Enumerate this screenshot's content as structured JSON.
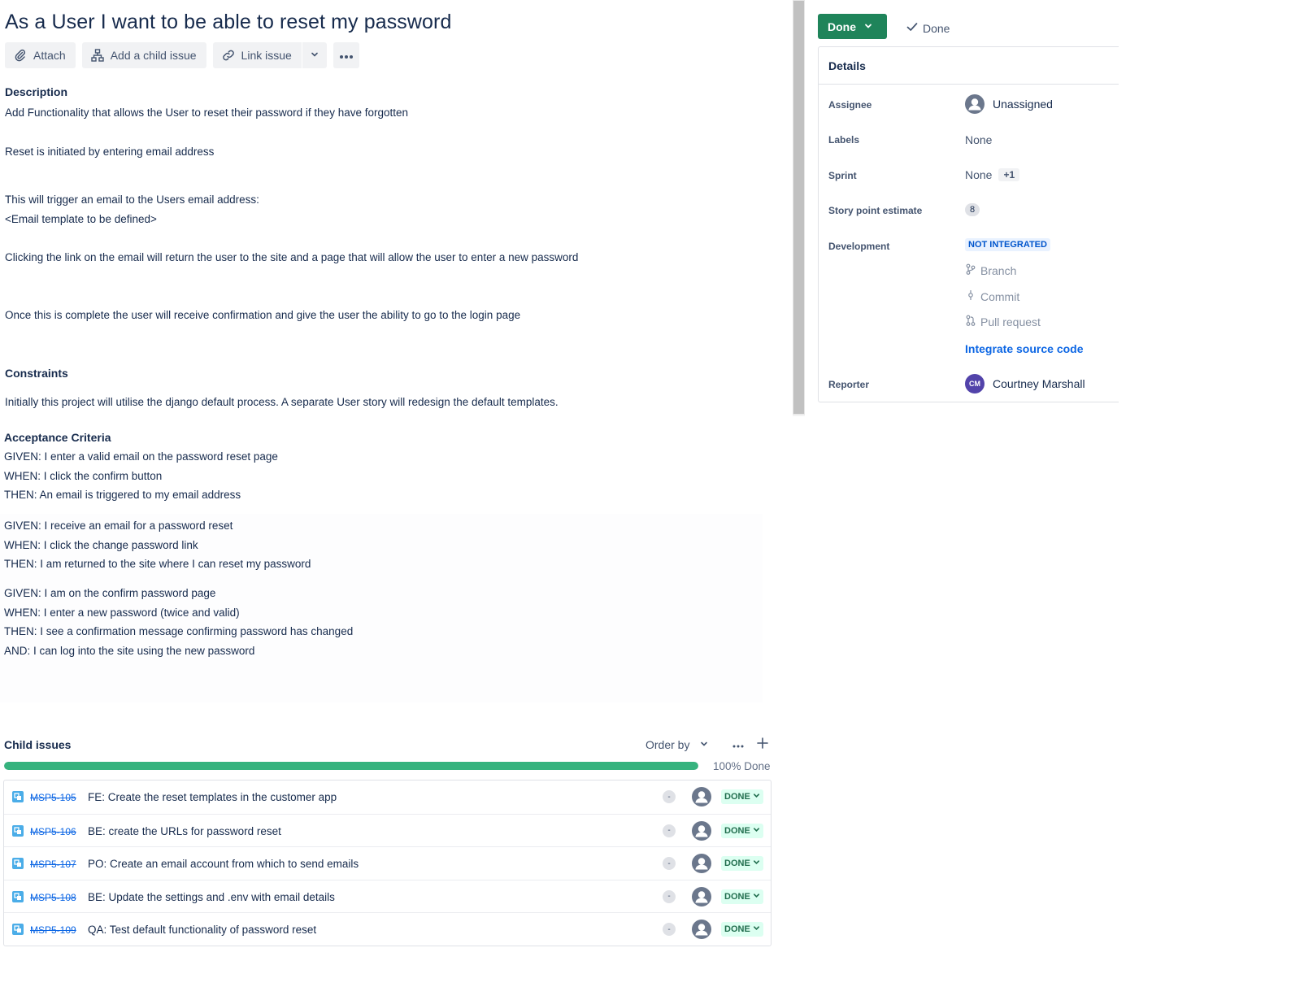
{
  "issue": {
    "title": "As a User I want to be able to reset my password"
  },
  "toolbar": {
    "attach": "Attach",
    "add_child": "Add a child issue",
    "link_issue": "Link issue"
  },
  "description": {
    "label": "Description",
    "paragraphs": [
      "Add Functionality that allows the User to reset their password if they have forgotten",
      "Reset is initiated by entering email address",
      "This will trigger an email to the Users email address:",
      "<Email template to be defined>",
      "Clicking the link on the email will return the user to the site and a page that will allow the user to enter a new password",
      "Once this is complete the user will receive confirmation and give the user the ability to go to the login page"
    ],
    "constraints_label": "Constraints",
    "constraints_text": "Initially this project will utilise the django default process. A separate User story will redesign the default templates.",
    "acceptance_label": "Acceptance Criteria",
    "acceptance": [
      "GIVEN: I enter a valid email on the password reset page",
      "WHEN: I click the confirm button",
      "THEN: An email is triggered to my email address",
      "GIVEN: I receive an email for a password reset",
      "WHEN: I click the change password link",
      "THEN: I am returned to the site where I can reset my password",
      "GIVEN: I am on the confirm password page",
      "WHEN: I enter a new password (twice and valid)",
      "THEN: I see a confirmation message confirming password has changed",
      "AND: I can log into the site using the new password"
    ]
  },
  "child_issues": {
    "label": "Child issues",
    "order_by": "Order by",
    "progress_percent": 100,
    "progress_text": "100% Done",
    "rows": [
      {
        "key": "MSP5-105",
        "summary": "FE: Create the reset templates in the customer app",
        "priority": "-",
        "status": "DONE"
      },
      {
        "key": "MSP5-106",
        "summary": "BE: create the URLs for password reset",
        "priority": "-",
        "status": "DONE"
      },
      {
        "key": "MSP5-107",
        "summary": "PO: Create an email account from which to send emails",
        "priority": "-",
        "status": "DONE"
      },
      {
        "key": "MSP5-108",
        "summary": "BE: Update the settings and .env with email details",
        "priority": "-",
        "status": "DONE"
      },
      {
        "key": "MSP5-109",
        "summary": "QA: Test default functionality of password reset",
        "priority": "-",
        "status": "DONE"
      }
    ]
  },
  "sidebar": {
    "status_button": "Done",
    "resolution": "Done",
    "details_label": "Details",
    "fields": {
      "assignee_label": "Assignee",
      "assignee_value": "Unassigned",
      "labels_label": "Labels",
      "labels_value": "None",
      "sprint_label": "Sprint",
      "sprint_value": "None",
      "sprint_extra": "+1",
      "story_points_label": "Story point estimate",
      "story_points_value": "8",
      "development_label": "Development",
      "development_status": "NOT INTEGRATED",
      "dev_branch": "Branch",
      "dev_commit": "Commit",
      "dev_pull_request": "Pull request",
      "integrate_link": "Integrate source code",
      "reporter_label": "Reporter",
      "reporter_initials": "CM",
      "reporter_name": "Courtney Marshall"
    }
  },
  "colors": {
    "status_green": "#1f845a",
    "progress_green": "#36b37e",
    "link_blue": "#0c66e4",
    "done_lozenge_bg": "#dcfff1",
    "reporter_avatar": "#5243aa"
  },
  "icons": [
    "paperclip-icon",
    "hierarchy-icon",
    "link-icon",
    "chevron-down-icon",
    "more-icon",
    "plus-icon",
    "check-icon",
    "subtask-icon",
    "user-avatar-icon",
    "branch-icon",
    "commit-icon",
    "pull-request-icon"
  ]
}
